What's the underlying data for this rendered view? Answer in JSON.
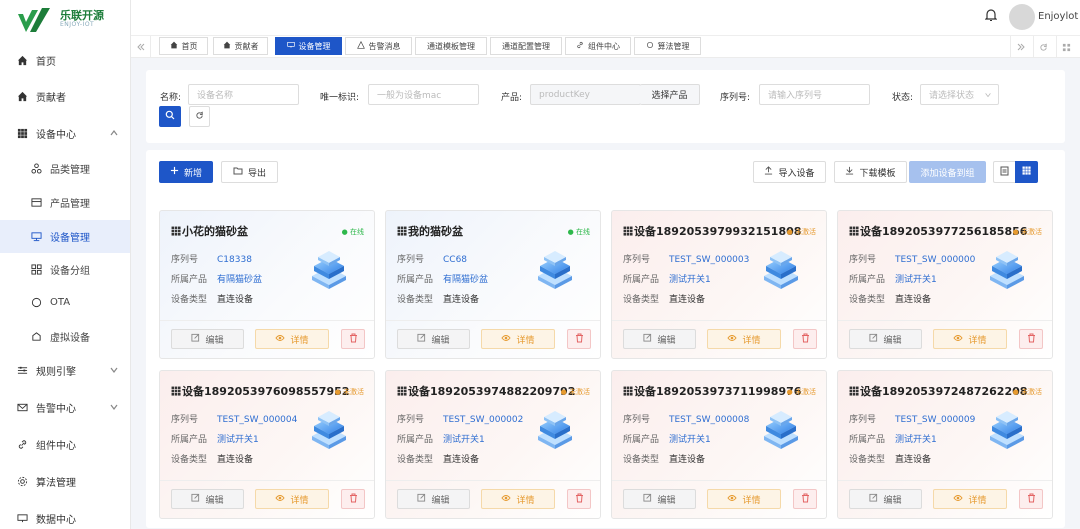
{
  "brand": {
    "name": "乐联开源",
    "sub": "ENJOY-IOT"
  },
  "sidebar": {
    "items": [
      {
        "label": "首页"
      },
      {
        "label": "贡献者"
      },
      {
        "label": "设备中心"
      },
      {
        "label": "品类管理"
      },
      {
        "label": "产品管理"
      },
      {
        "label": "设备管理"
      },
      {
        "label": "设备分组"
      },
      {
        "label": "OTA"
      },
      {
        "label": "虚拟设备"
      },
      {
        "label": "规则引擎"
      },
      {
        "label": "告警中心"
      },
      {
        "label": "组件中心"
      },
      {
        "label": "算法管理"
      },
      {
        "label": "数据中心"
      }
    ]
  },
  "header": {
    "username": "Enjoylot"
  },
  "tabs": [
    {
      "label": "首页"
    },
    {
      "label": "贡献者"
    },
    {
      "label": "设备管理"
    },
    {
      "label": "告警消息"
    },
    {
      "label": "通道模板管理"
    },
    {
      "label": "通道配置管理"
    },
    {
      "label": "组件中心"
    },
    {
      "label": "算法管理"
    }
  ],
  "filter": {
    "name_label": "名称:",
    "name_placeholder": "设备名称",
    "uid_label": "唯一标识:",
    "uid_placeholder": "一般为设备mac",
    "product_label": "产品:",
    "product_placeholder": "productKey",
    "product_select": "选择产品",
    "serial_label": "序列号:",
    "serial_placeholder": "请输入序列号",
    "state_label": "状态:",
    "state_placeholder": "请选择状态"
  },
  "toolbar": {
    "add": "新增",
    "export": "导出",
    "import": "导入设备",
    "download": "下载模板",
    "addgroup": "添加设备到组"
  },
  "card_labels": {
    "serial": "序列号",
    "product": "所属产品",
    "type": "设备类型",
    "edit": "编辑",
    "detail": "详情"
  },
  "devices": [
    {
      "name": "小花的猫砂盆",
      "status": "在线",
      "serial": "C18338",
      "product": "有隔猫砂盆",
      "type": "直连设备"
    },
    {
      "name": "我的猫砂盆",
      "status": "在线",
      "serial": "CC68",
      "product": "有隔猫砂盆",
      "type": "直连设备"
    },
    {
      "name": "设备1892053979932151808",
      "status": "未激活",
      "serial": "TEST_SW_000003",
      "product": "测试开关1",
      "type": "直连设备"
    },
    {
      "name": "设备1892053977256185856",
      "status": "未激活",
      "serial": "TEST_SW_000000",
      "product": "测试开关1",
      "type": "直连设备"
    },
    {
      "name": "设备1892053976098557952",
      "status": "未激活",
      "serial": "TEST_SW_000004",
      "product": "测试开关1",
      "type": "直连设备"
    },
    {
      "name": "设备1892053974882209792",
      "status": "未激活",
      "serial": "TEST_SW_000002",
      "product": "测试开关1",
      "type": "直连设备"
    },
    {
      "name": "设备1892053973711998976",
      "status": "未激活",
      "serial": "TEST_SW_000008",
      "product": "测试开关1",
      "type": "直连设备"
    },
    {
      "name": "设备1892053972487262208",
      "status": "未激活",
      "serial": "TEST_SW_000009",
      "product": "测试开关1",
      "type": "直连设备"
    }
  ],
  "colors": {
    "primary": "#1e56c8",
    "online": "#2eb84b",
    "inactive": "#e69a2f",
    "danger": "#e36464"
  }
}
